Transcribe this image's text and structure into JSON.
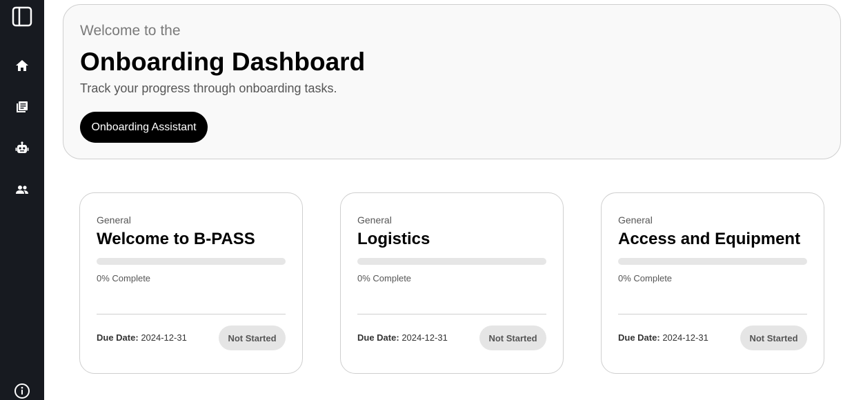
{
  "sidebar": {
    "items": [
      {
        "icon": "panel-toggle-icon"
      },
      {
        "icon": "home-icon"
      },
      {
        "icon": "document-list-icon"
      },
      {
        "icon": "robot-icon"
      },
      {
        "icon": "people-icon"
      },
      {
        "icon": "info-icon"
      }
    ],
    "background": "#171a20"
  },
  "hero": {
    "subtitle": "Welcome to the",
    "title": "Onboarding Dashboard",
    "description": "Track your progress through onboarding tasks.",
    "button_label": "Onboarding Assistant"
  },
  "cards": [
    {
      "category": "General",
      "title": "Welcome to B-PASS",
      "progress": 0,
      "progress_label": "0% Complete",
      "due_label": "Due Date:",
      "due_date": "2024-12-31",
      "status": "Not Started"
    },
    {
      "category": "General",
      "title": "Logistics",
      "progress": 0,
      "progress_label": "0% Complete",
      "due_label": "Due Date:",
      "due_date": "2024-12-31",
      "status": "Not Started"
    },
    {
      "category": "General",
      "title": "Access and Equipment",
      "progress": 0,
      "progress_label": "0% Complete",
      "due_label": "Due Date:",
      "due_date": "2024-12-31",
      "status": "Not Started"
    }
  ]
}
